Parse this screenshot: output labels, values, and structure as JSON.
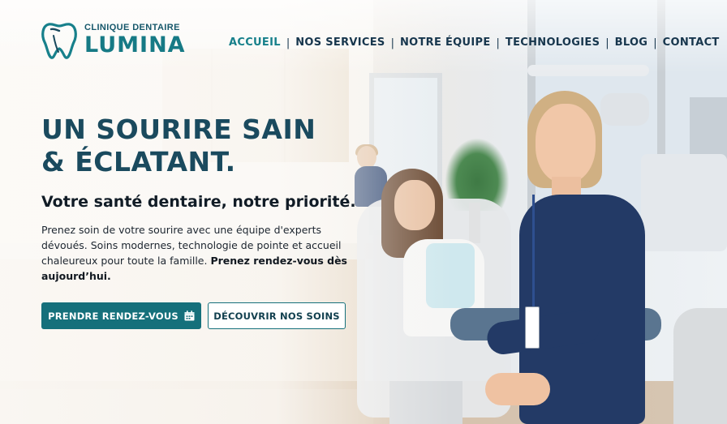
{
  "brand": {
    "subtitle": "CLINIQUE DENTAIRE",
    "name": "LUMINA",
    "logo_icon": "tooth-icon",
    "primary_color": "#15707b",
    "title_color": "#1a4a5e"
  },
  "nav": {
    "items": [
      {
        "label": "ACCUEIL",
        "active": true
      },
      {
        "label": "NOS SERVICES",
        "active": false
      },
      {
        "label": "NOTRE ÉQUIPE",
        "active": false
      },
      {
        "label": "TECHNOLOGIES",
        "active": false
      },
      {
        "label": "BLOG",
        "active": false
      },
      {
        "label": "CONTACT",
        "active": false
      }
    ],
    "separator": "|"
  },
  "hero": {
    "title_line1": "UN SOURIRE SAIN",
    "title_line2": "& ÉCLATANT.",
    "subtitle": "Votre santé dentaire, notre priorité.",
    "body": "Prenez soin de votre sourire avec une équipe d'experts dévoués. Soins modernes, technologie de pointe et accueil chaleureux pour toute la famille.",
    "body_strong": "Prenez rendez-vous dès aujourd’hui."
  },
  "cta": {
    "primary_label": "PRENDRE RENDEZ-VOUS",
    "primary_icon": "calendar-icon",
    "secondary_label": "DÉCOUVRIR NOS SOINS"
  }
}
